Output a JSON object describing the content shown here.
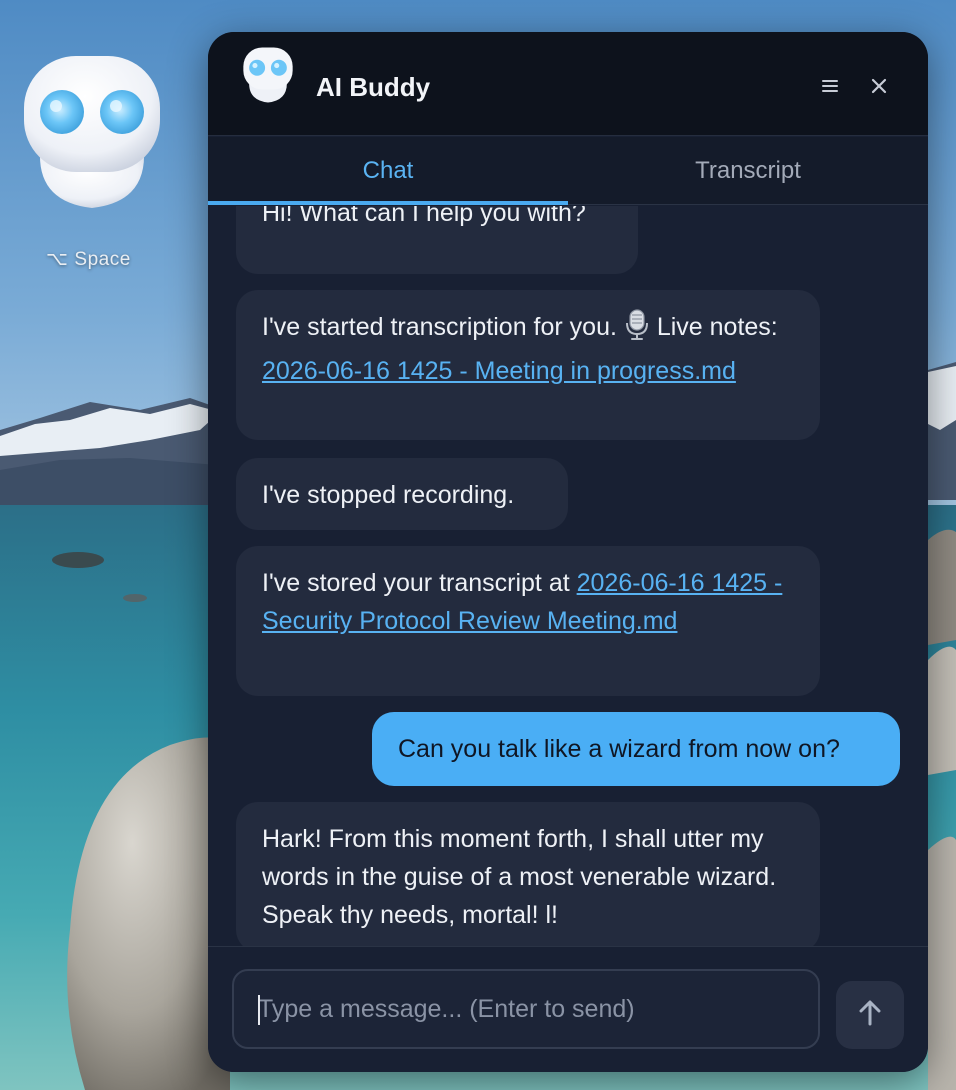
{
  "desktop": {
    "shortcut_symbol": "⌥",
    "shortcut_key": "Space"
  },
  "window": {
    "title": "AI Buddy",
    "menu_icon": "hamburger-menu-icon",
    "close_icon": "close-icon"
  },
  "tabs": [
    {
      "label": "Chat",
      "active": true
    },
    {
      "label": "Transcript",
      "active": false
    }
  ],
  "messages": [
    {
      "role": "assistant",
      "text": "Hi! What can I help you with?"
    },
    {
      "role": "assistant",
      "text_before": "I've started transcription for you. ",
      "icon": "microphone-icon",
      "text_middle": " Live notes: ",
      "link": "2026-06-16 1425 - Meeting in progress.md"
    },
    {
      "role": "assistant",
      "text": "I've stopped recording."
    },
    {
      "role": "assistant",
      "text_before": "I've stored your transcript at ",
      "link": "2026-06-16 1425 - Security Protocol Review Meeting.md"
    },
    {
      "role": "user",
      "text": "Can you talk like a wizard from now on?"
    },
    {
      "role": "assistant",
      "text": "Hark! From this moment forth, I shall utter my words in the guise of a most venerable wizard. Speak thy needs, mortal! l!"
    }
  ],
  "composer": {
    "placeholder": "Type a message... (Enter to send)",
    "value": "",
    "send_icon": "arrow-up-icon"
  },
  "colors": {
    "window_bg": "#182033",
    "header_bg": "#0d121c",
    "accent": "#4aaaf0",
    "bot_bubble": "#232b3e",
    "user_bubble": "#4aaef5",
    "link": "#58b2f2"
  }
}
